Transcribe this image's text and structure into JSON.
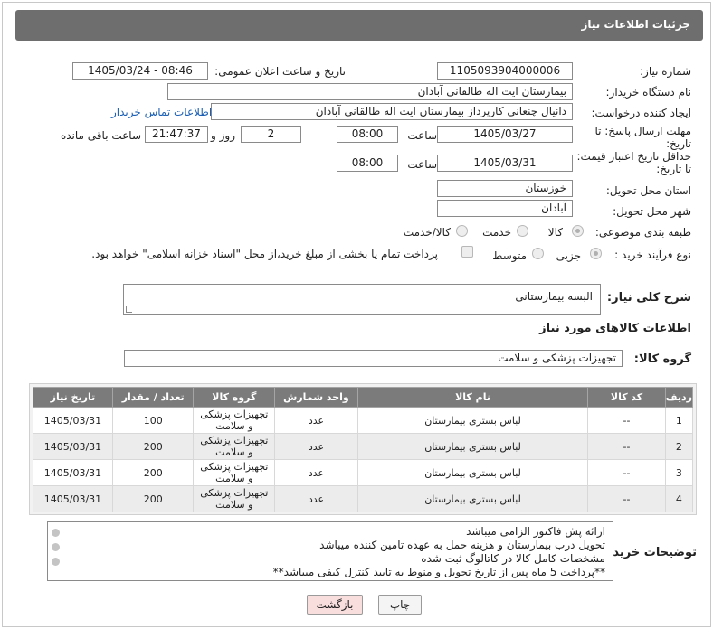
{
  "header": {
    "title": "جزئیات اطلاعات نیاز"
  },
  "form": {
    "need_number_label": "شماره نیاز:",
    "need_number": "1105093904000006",
    "announce_label": "تاریخ و ساعت اعلان عمومی:",
    "announce_value": "1405/03/24 - 08:46",
    "buyer_org_label": "نام دستگاه خریدار:",
    "buyer_org": "بیمارستان ایت اله طالقانی آبادان",
    "creator_label": "ایجاد کننده درخواست:",
    "creator": "دانیال چنعانی کارپرداز بیمارستان ایت اله طالقانی آبادان",
    "contact_link": "اطلاعات تماس خریدار",
    "deadline_label_1": "مهلت ارسال پاسخ: تا",
    "deadline_label_2": "تاریخ:",
    "deadline_date": "1405/03/27",
    "time_label": "ساعت",
    "deadline_time": "08:00",
    "days_value": "2",
    "days_label": "روز و",
    "remaining_time": "21:47:37",
    "remaining_label": "ساعت باقی مانده",
    "validity_label_1": "حداقل تاریخ اعتبار قیمت:",
    "validity_label_2": "تا تاریخ:",
    "validity_date": "1405/03/31",
    "validity_time": "08:00",
    "province_label": "استان محل تحویل:",
    "province": "خوزستان",
    "city_label": "شهر محل تحویل:",
    "city": "آبادان",
    "category_label": "طبقه بندی موضوعی:",
    "category_options": [
      "کالا",
      "خدمت",
      "کالا/خدمت"
    ],
    "process_label": "نوع فرآیند خرید :",
    "process_options": [
      "جزیی",
      "متوسط"
    ],
    "payment_note": "پرداخت تمام یا بخشی از مبلغ خرید،از محل \"اسناد خزانه اسلامی\" خواهد بود.",
    "description_label": "شرح کلی نیاز:",
    "description": "البسه بیمارستانی",
    "goods_info_title": "اطلاعات کالاهای مورد نیاز",
    "goods_group_label": "گروه کالا:",
    "goods_group": "تجهیزات پزشکی و سلامت"
  },
  "table": {
    "headers": [
      "ردیف",
      "کد کالا",
      "نام کالا",
      "واحد شمارش",
      "گروه کالا",
      "تعداد / مقدار",
      "تاریخ نیاز"
    ],
    "rows": [
      [
        "1",
        "--",
        "لباس بستری بیمارستان",
        "عدد",
        "تجهیزات پزشکی و سلامت",
        "100",
        "1405/03/31"
      ],
      [
        "2",
        "--",
        "لباس بستری بیمارستان",
        "عدد",
        "تجهیزات پزشکی و سلامت",
        "200",
        "1405/03/31"
      ],
      [
        "3",
        "--",
        "لباس بستری بیمارستان",
        "عدد",
        "تجهیزات پزشکی و سلامت",
        "200",
        "1405/03/31"
      ],
      [
        "4",
        "--",
        "لباس بستری بیمارستان",
        "عدد",
        "تجهیزات پزشکی و سلامت",
        "200",
        "1405/03/31"
      ]
    ]
  },
  "notes": {
    "label": "توضیحات خریدار:",
    "lines": [
      "ارائه پش فاکتور الزامی میباشد",
      "تحویل درب بیمارستان و هزینه حمل به عهده تامین کننده میباشد",
      "مشخصات کامل کالا در کاتالوگ ثبت شده",
      "**پرداخت 5 ماه پس از تاریخ تحویل و منوط به تایید کنترل کیفی میباشد**"
    ]
  },
  "buttons": {
    "print": "چاپ",
    "back": "بازگشت"
  },
  "colors": {
    "header_bg": "#6e6e6e",
    "link": "#1a5fb4",
    "back_button_bg": "#f9dede",
    "print_button_bg": "#f4f4f4"
  }
}
